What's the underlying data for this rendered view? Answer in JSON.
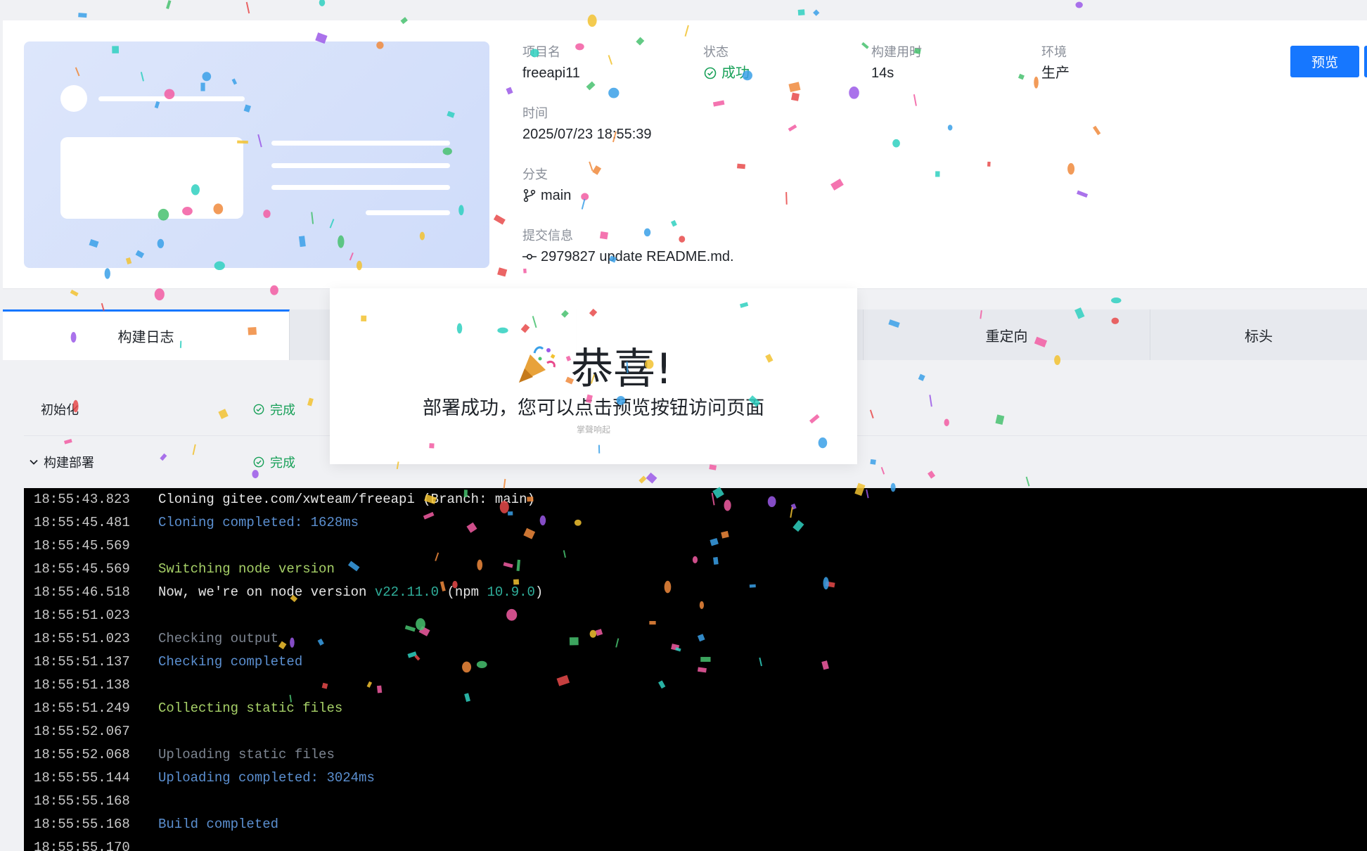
{
  "project": {
    "name_label": "项目名",
    "name_value": "freeapi11",
    "status_label": "状态",
    "status_value": "成功",
    "duration_label": "构建用时",
    "duration_value": "14s",
    "env_label": "环境",
    "env_value": "生产",
    "time_label": "时间",
    "time_value": "2025/07/23 18:55:39",
    "branch_label": "分支",
    "branch_value": "main",
    "commit_label": "提交信息",
    "commit_value": "2979827 update README.md.",
    "preview_button": "预览"
  },
  "tabs": [
    {
      "label": "构建日志",
      "active": true
    },
    {
      "label": "",
      "active": false
    },
    {
      "label": "",
      "active": false
    },
    {
      "label": "重定向",
      "active": false
    },
    {
      "label": "标头",
      "active": false
    }
  ],
  "steps": [
    {
      "name": "初始化",
      "status": "完成"
    },
    {
      "name": "构建部署",
      "status": "完成"
    }
  ],
  "logs": [
    {
      "time": "18:55:43.823",
      "segments": [
        {
          "text": "Cloning gitee.com/xwteam/freeapi (Branch: main)",
          "color": "white"
        }
      ]
    },
    {
      "time": "18:55:45.481",
      "segments": [
        {
          "text": "Cloning completed: 1628ms",
          "color": "blue"
        }
      ]
    },
    {
      "time": "18:55:45.569",
      "segments": []
    },
    {
      "time": "18:55:45.569",
      "segments": [
        {
          "text": "Switching node version",
          "color": "green"
        }
      ]
    },
    {
      "time": "18:55:46.518",
      "segments": [
        {
          "text": "Now, we're on node version ",
          "color": "white"
        },
        {
          "text": "v22.11.0",
          "color": "teal"
        },
        {
          "text": " (npm ",
          "color": "white"
        },
        {
          "text": "10.9.0",
          "color": "teal"
        },
        {
          "text": ")",
          "color": "white"
        }
      ]
    },
    {
      "time": "18:55:51.023",
      "segments": []
    },
    {
      "time": "18:55:51.023",
      "segments": [
        {
          "text": "Checking output",
          "color": "gray"
        }
      ]
    },
    {
      "time": "18:55:51.137",
      "segments": [
        {
          "text": "Checking completed",
          "color": "blue"
        }
      ]
    },
    {
      "time": "18:55:51.138",
      "segments": []
    },
    {
      "time": "18:55:51.249",
      "segments": [
        {
          "text": "Collecting static files",
          "color": "green"
        }
      ]
    },
    {
      "time": "18:55:52.067",
      "segments": []
    },
    {
      "time": "18:55:52.068",
      "segments": [
        {
          "text": "Uploading static files",
          "color": "gray"
        }
      ]
    },
    {
      "time": "18:55:55.144",
      "segments": [
        {
          "text": "Uploading completed: 3024ms",
          "color": "blue"
        }
      ]
    },
    {
      "time": "18:55:55.168",
      "segments": []
    },
    {
      "time": "18:55:55.168",
      "segments": [
        {
          "text": "Build completed",
          "color": "blue"
        }
      ]
    },
    {
      "time": "18:55:55.170",
      "segments": []
    }
  ],
  "modal": {
    "emoji": "🎉",
    "title": "恭喜!",
    "subtitle": "部署成功，您可以点击预览按钮访问页面",
    "faint": "掌聲响起"
  },
  "colors": {
    "accent": "#1677ff",
    "success": "#18a058"
  },
  "icons": {
    "status": "check-circle-icon",
    "branch": "git-branch-icon",
    "commit": "git-commit-icon",
    "expand": "chevron-down-icon",
    "party": "party-popper-icon"
  }
}
